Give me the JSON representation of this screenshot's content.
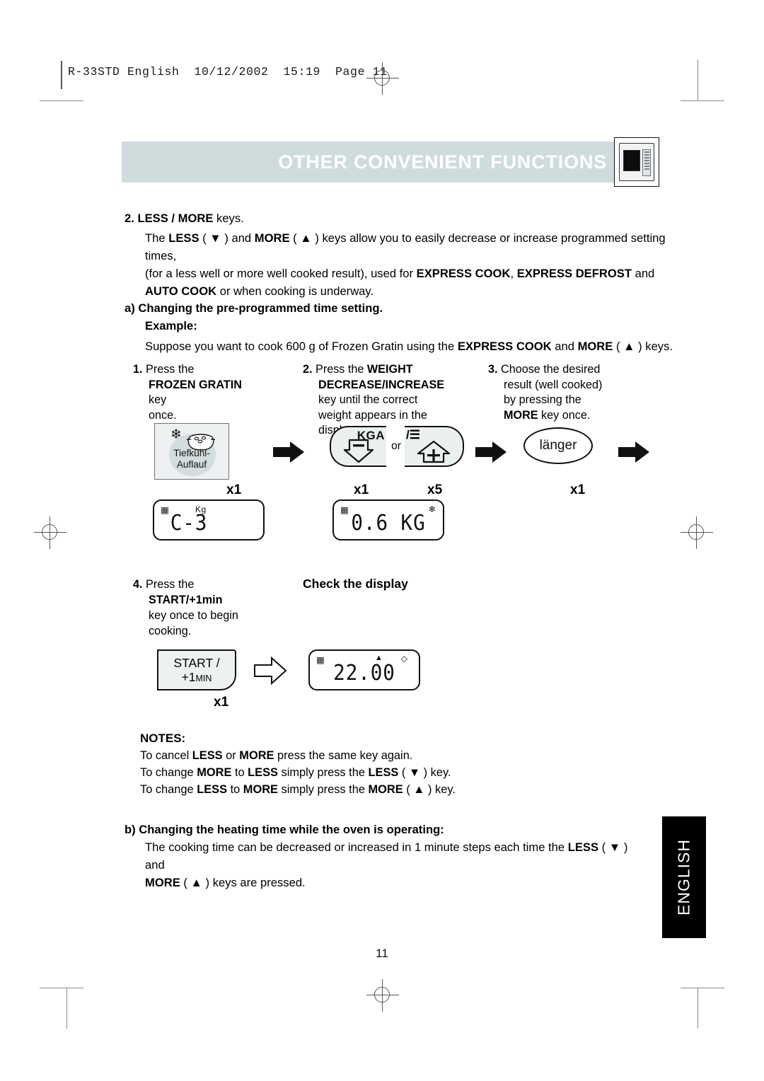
{
  "doc_header": "R-33STD English  10/12/2002  15:19  Page 11",
  "banner": {
    "title": "OTHER CONVENIENT FUNCTIONS",
    "bg_color": "#cfdcdd",
    "icon": "microwave-oven-icon"
  },
  "section2": {
    "heading_num": "2.",
    "heading_bold": "LESS / MORE",
    "heading_rest": " keys.",
    "line1_a": "The ",
    "line1_b": "LESS",
    "line1_c": " ( ▼ ) and ",
    "line1_d": "MORE",
    "line1_e": " ( ▲ ) keys allow you to easily decrease or increase programmed setting times,",
    "line2_a": "(for a less well or more well cooked result), used for ",
    "line2_b": "EXPRESS COOK",
    "line2_c": ", ",
    "line2_d": "EXPRESS DEFROST",
    "line2_e": " and",
    "line3_a": "AUTO COOK",
    "line3_b": " or when cooking is underway."
  },
  "section_a": {
    "heading": "a) Changing the pre-programmed time setting.",
    "example_label": "Example:",
    "body_a": "Suppose you want to cook 600 g of Frozen Gratin using the ",
    "body_b": "EXPRESS COOK",
    "body_c": " and ",
    "body_d": "MORE",
    "body_e": "  ( ▲ ) keys."
  },
  "steps": [
    {
      "num": "1.",
      "l1": "Press the",
      "l2_bold": "FROZEN GRATIN",
      "l2_rest": " key",
      "l3": "once."
    },
    {
      "num": "2.",
      "l1": "Press the ",
      "l1_bold": "WEIGHT",
      "l2_bold": "DECREASE/INCREASE",
      "l3": "key until the correct",
      "l4": "weight appears in the",
      "l5": "display."
    },
    {
      "num": "3.",
      "l1": "Choose the desired",
      "l2": "result (well cooked)",
      "l3": "by pressing the",
      "l4_bold": "MORE",
      "l4_rest": " key once."
    }
  ],
  "keys": {
    "gratin": {
      "label_line1": "Tiefkühl-",
      "label_line2": "Auflauf",
      "icon": "frozen-gratin-icon",
      "count": "x1"
    },
    "weight_decrease": {
      "text": "KGA",
      "icon": "down-arrow-minus-icon"
    },
    "or_label": "or",
    "weight_increase": {
      "text": "/☰",
      "icon": "up-arrow-plus-icon"
    },
    "weight_count": "x1",
    "weight_count_2": "x5",
    "langer": {
      "label": "länger",
      "count": "x1"
    },
    "start": {
      "line1": "START /",
      "line2_plus": "+1",
      "line2_min": "MIN",
      "count": "x1"
    }
  },
  "displays": {
    "d1": {
      "value": "C-3",
      "ico_left": "grill-icon",
      "ico_kg": "Kg"
    },
    "d2": {
      "value": "0.6 KG",
      "ico_left": "grill-icon",
      "ico_right": "snowflake-icon"
    },
    "d3": {
      "value": "22.00",
      "ico_left": "grill-icon",
      "ico_tri": "▲",
      "ico_diam": "◇"
    }
  },
  "step4": {
    "num": "4.",
    "l1": "Press the",
    "l2_bold": "START/+1min",
    "l3": "key once to begin",
    "l4": "cooking."
  },
  "check_display": "Check the display",
  "notes": {
    "heading": "NOTES:",
    "n1_a": "To cancel ",
    "n1_b": "LESS",
    "n1_c": " or ",
    "n1_d": "MORE",
    "n1_e": "  press the same key again.",
    "n2_a": "To change ",
    "n2_b": "MORE",
    "n2_c": " to ",
    "n2_d": "LESS",
    "n2_e": " simply press the ",
    "n2_f": "LESS",
    "n2_g": " ( ▼ ) key.",
    "n3_a": "To change ",
    "n3_b": "LESS",
    "n3_c": " to ",
    "n3_d": "MORE",
    "n3_e": " simply press the ",
    "n3_f": "MORE",
    "n3_g": " ( ▲ ) key."
  },
  "section_b": {
    "heading": "b) Changing the heating time while the oven is operating:",
    "body_a": "The cooking time can be decreased or increased in 1 minute steps each time the ",
    "body_b": "LESS",
    "body_c": " ( ▼ )  and",
    "body_d": "MORE",
    "body_e": " ( ▲ ) keys are pressed."
  },
  "language_tab": "ENGLISH",
  "page_number": "11"
}
